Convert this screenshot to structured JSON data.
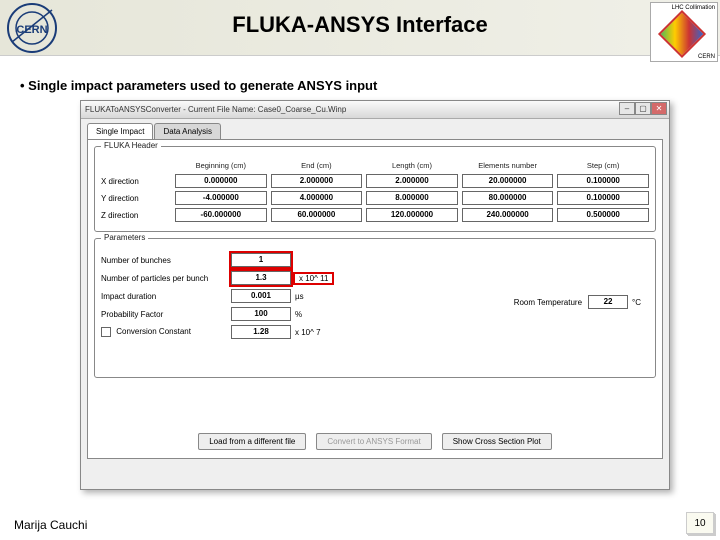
{
  "slide": {
    "title": "FLUKA-ANSYS Interface",
    "bullet": "Single impact parameters used to generate ANSYS input",
    "author": "Marija Cauchi",
    "page": "10",
    "lhc_label": "LHC Collimation",
    "cern_label": "CERN"
  },
  "window": {
    "title": "FLUKAToANSYSConverter - Current File Name: Case0_Coarse_Cu.Winp",
    "tabs": [
      "Single Impact",
      "Data Analysis"
    ],
    "active_tab": 0
  },
  "fluka": {
    "group": "FLUKA Header",
    "headers": [
      "",
      "Beginning (cm)",
      "End (cm)",
      "Length (cm)",
      "Elements number",
      "Step (cm)"
    ],
    "rows": [
      {
        "label": "X direction",
        "vals": [
          "0.000000",
          "2.000000",
          "2.000000",
          "20.000000",
          "0.100000"
        ]
      },
      {
        "label": "Y direction",
        "vals": [
          "-4.000000",
          "4.000000",
          "8.000000",
          "80.000000",
          "0.100000"
        ]
      },
      {
        "label": "Z direction",
        "vals": [
          "-60.000000",
          "60.000000",
          "120.000000",
          "240.000000",
          "0.500000"
        ]
      }
    ]
  },
  "params": {
    "group": "Parameters",
    "items": [
      {
        "label": "Number of bunches",
        "val": "1",
        "unit": "",
        "hl": true
      },
      {
        "label": "Number of particles per bunch",
        "val": "1.3",
        "unit": "x 10^   11",
        "hl": true
      },
      {
        "label": "Impact duration",
        "val": "0.001",
        "unit": "µs"
      },
      {
        "label": "Probability Factor",
        "val": "100",
        "unit": "%"
      },
      {
        "label": "Conversion Constant",
        "val": "1.28",
        "unit": "x 10^   7",
        "cb": true
      }
    ],
    "room_temp_label": "Room Temperature",
    "room_temp_val": "22",
    "room_temp_unit": "°C"
  },
  "buttons": {
    "load": "Load from a different file",
    "convert": "Convert to ANSYS Format",
    "plot": "Show Cross Section Plot"
  }
}
